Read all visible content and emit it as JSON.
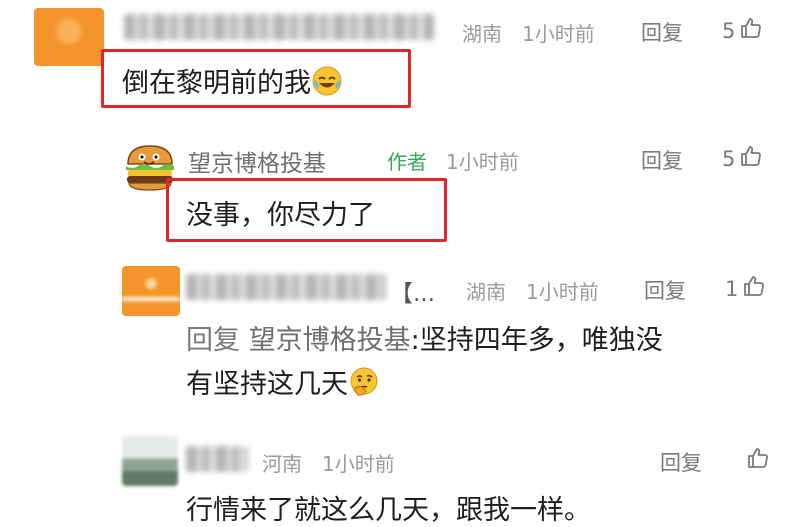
{
  "comments": [
    {
      "name_blurred": true,
      "region": "湖南",
      "time": "1小时前",
      "reply_label": "回复",
      "likes": "5",
      "content": "倒在黎明前的我",
      "emoji": "laughing-tears-emoji"
    },
    {
      "name": "望京博格投基",
      "author_tag": "作者",
      "time": "1小时前",
      "reply_label": "回复",
      "likes": "5",
      "content": "没事，你尽力了"
    },
    {
      "name_blurred": true,
      "name_suffix": "【...",
      "region": "湖南",
      "time": "1小时前",
      "reply_label": "回复",
      "likes": "1",
      "content_prefix": "回复",
      "content_target": "望京博格投基",
      "content_line1": "坚持四年多，唯独没",
      "content_line2": "有坚持这几天",
      "emoji": "thinking-emoji"
    },
    {
      "name_blurred": true,
      "region": "河南",
      "time": "1小时前",
      "reply_label": "回复",
      "content": "行情来了就这么几天，跟我一样。"
    }
  ],
  "colors": {
    "highlight": "#e0262a",
    "author_tag": "#3aa85a",
    "avatar_orange": "#f5942b"
  },
  "icons": {
    "like": "thumbs-up-icon"
  }
}
